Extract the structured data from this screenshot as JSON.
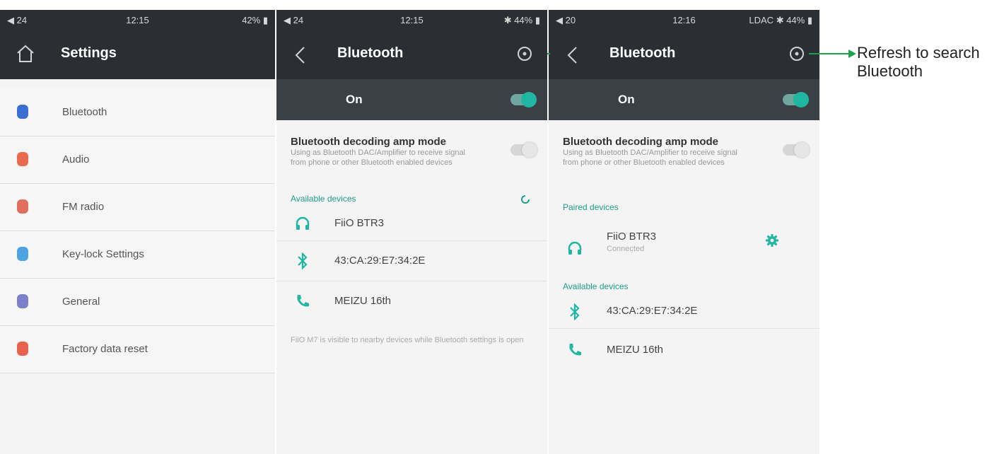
{
  "screens": {
    "settings": {
      "status": {
        "volume": "24",
        "time": "12:15",
        "battery": "42%"
      },
      "title": "Settings",
      "items": [
        {
          "label": "Bluetooth",
          "color": "#3b6fd4"
        },
        {
          "label": "Audio",
          "color": "#e86a4f"
        },
        {
          "label": "FM radio",
          "color": "#e0705e"
        },
        {
          "label": "Key-lock Settings",
          "color": "#4ea3e0"
        },
        {
          "label": "General",
          "color": "#7d7fc8"
        },
        {
          "label": "Factory data reset",
          "color": "#e8604f"
        }
      ]
    },
    "bt_search": {
      "status": {
        "volume": "24",
        "time": "12:15",
        "battery": "44%"
      },
      "title": "Bluetooth",
      "on_label": "On",
      "amp_title": "Bluetooth decoding amp mode",
      "amp_desc": "Using as Bluetooth DAC/Amplifier to receive signal from phone or other Bluetooth enabled devices",
      "available_label": "Available devices",
      "devices": [
        {
          "name": "FiiO BTR3",
          "icon": "headphones-icon"
        },
        {
          "name": "43:CA:29:E7:34:2E",
          "icon": "bluetooth-icon"
        },
        {
          "name": "MEIZU 16th",
          "icon": "phone-icon"
        }
      ],
      "footer": "FiiO M7 is visible to nearby devices while Bluetooth settings is open"
    },
    "bt_paired": {
      "status": {
        "volume": "20",
        "time": "12:16",
        "right": "LDAC",
        "battery": "44%"
      },
      "title": "Bluetooth",
      "on_label": "On",
      "amp_title": "Bluetooth decoding amp mode",
      "amp_desc": "Using as Bluetooth DAC/Amplifier to receive signal from phone or other Bluetooth enabled devices",
      "paired_label": "Paired devices",
      "paired_device": {
        "name": "FiiO BTR3",
        "status": "Connected",
        "icon": "headphones-icon"
      },
      "available_label": "Available devices",
      "devices": [
        {
          "name": "43:CA:29:E7:34:2E",
          "icon": "bluetooth-icon"
        },
        {
          "name": "MEIZU 16th",
          "icon": "phone-icon"
        }
      ]
    }
  },
  "annotation": {
    "line1": "Refresh to search",
    "line2": "Bluetooth"
  },
  "colors": {
    "accent": "#1fb6a2",
    "dark_bar": "#2b2f33",
    "arrow": "#1aa34a"
  }
}
